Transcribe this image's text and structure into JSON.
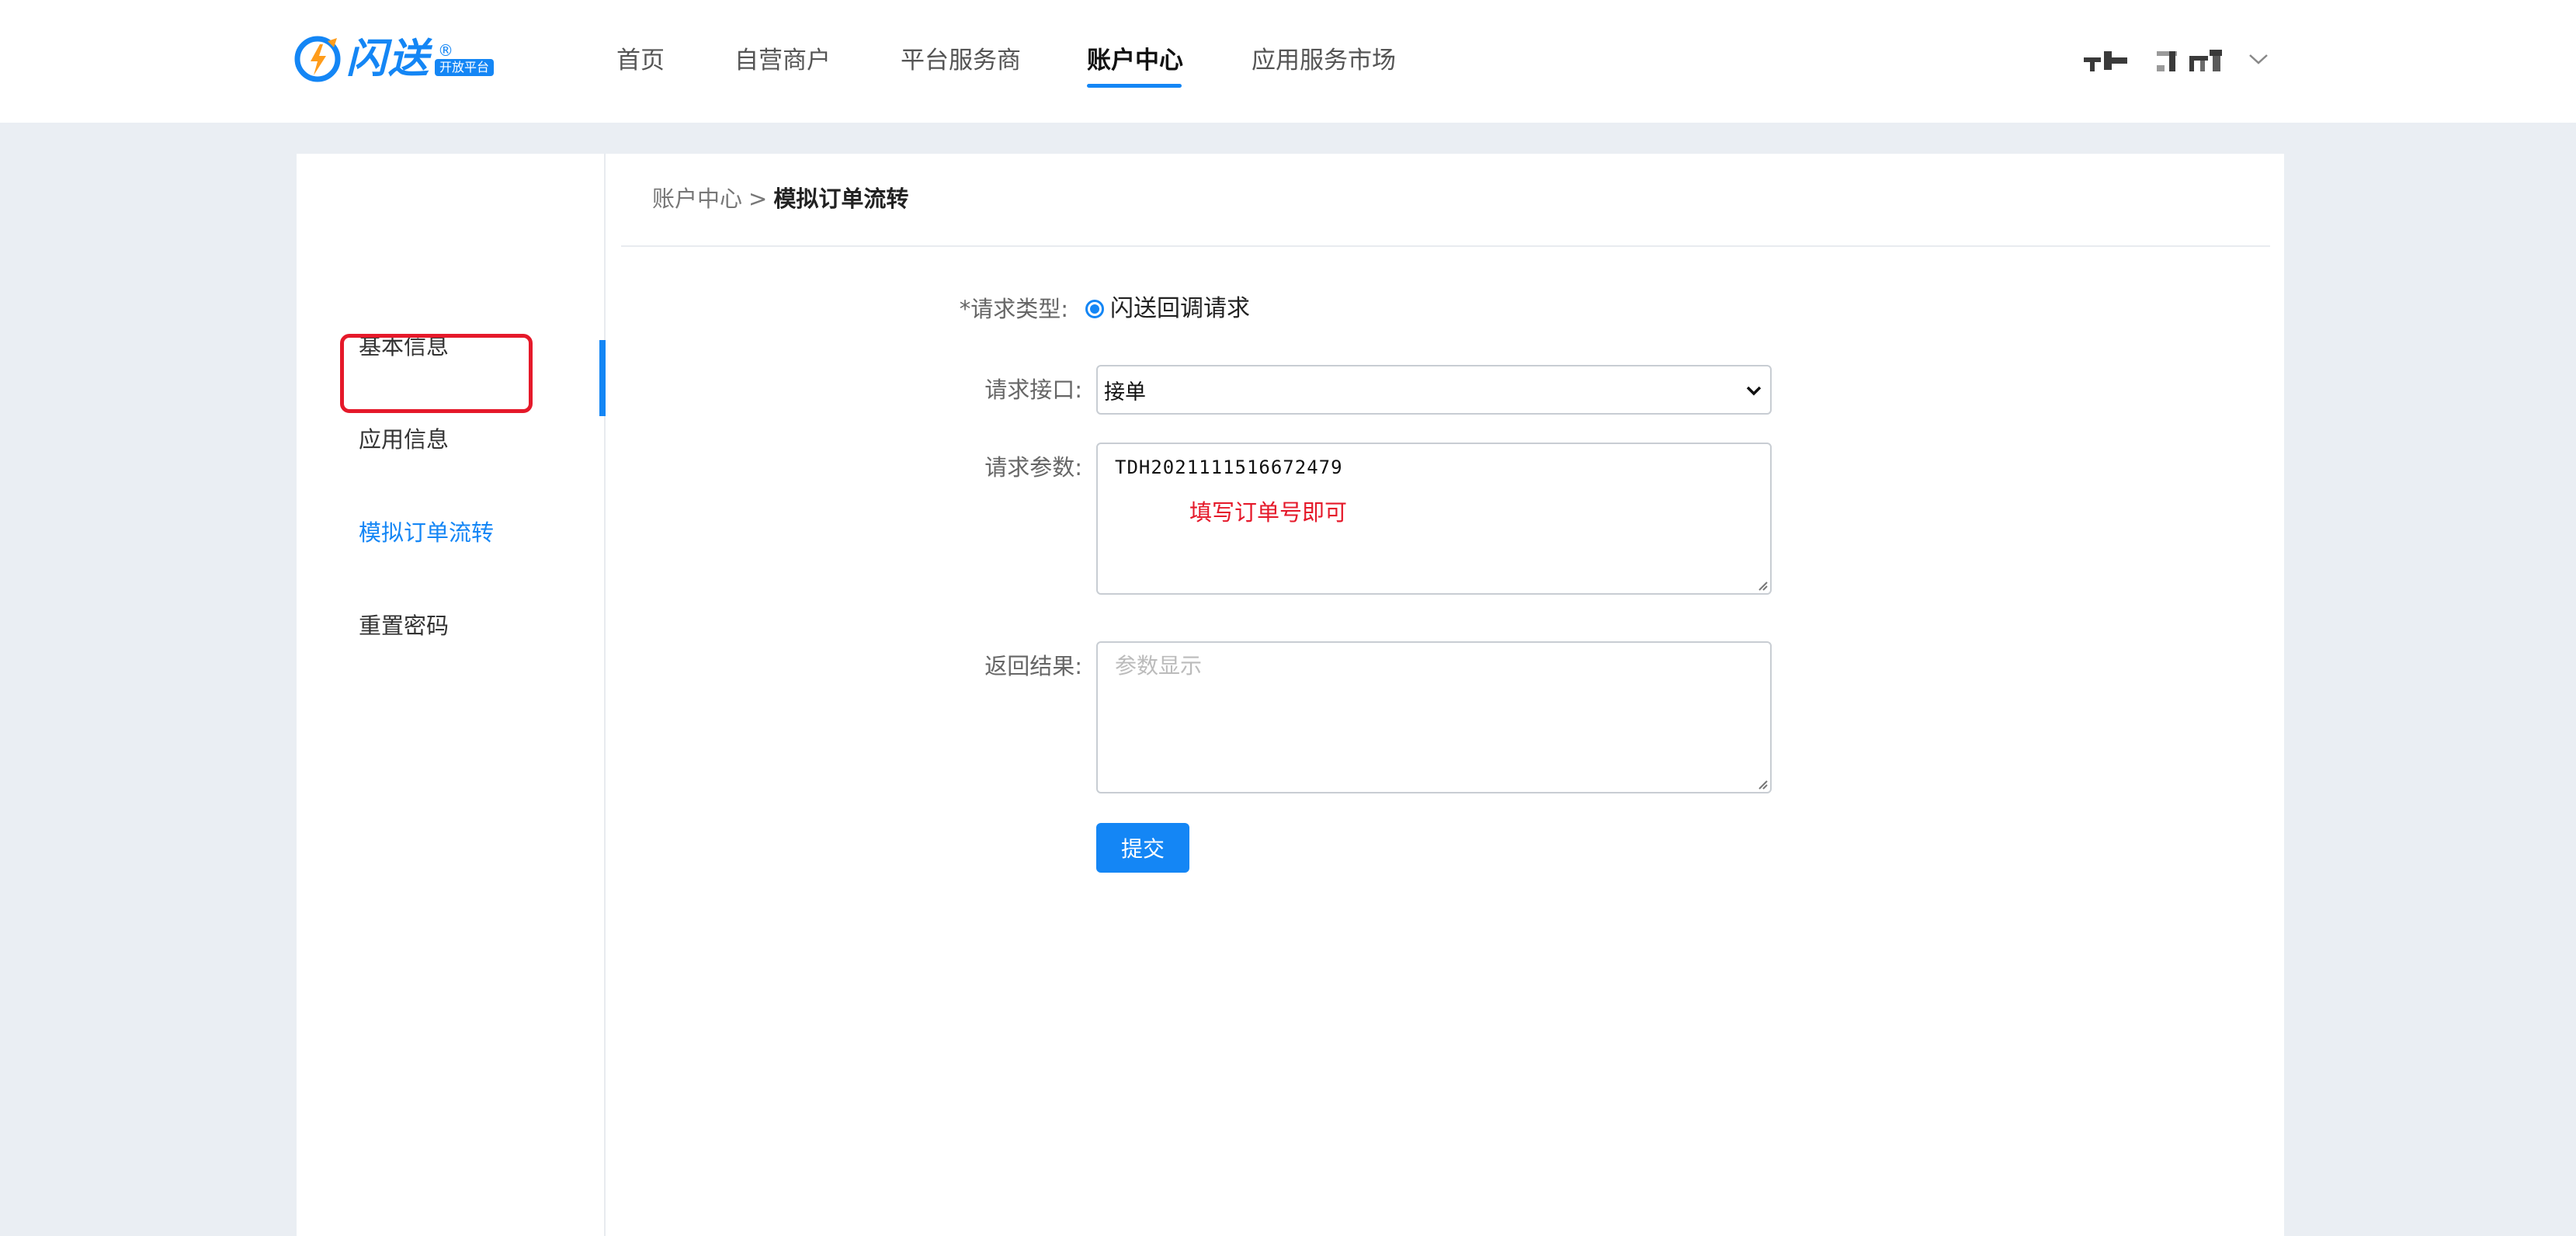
{
  "header": {
    "logo": {
      "brand": "闪送",
      "reg_mark": "®",
      "badge": "开放平台",
      "icon": "lightning-logo-icon"
    },
    "nav": [
      {
        "label": "首页"
      },
      {
        "label": "自营商户"
      },
      {
        "label": "平台服务商"
      },
      {
        "label": "账户中心",
        "active": true
      },
      {
        "label": "应用服务市场"
      }
    ],
    "user": {
      "chevron_icon": "chevron-down-icon"
    }
  },
  "sidebar": {
    "items": [
      {
        "label": "基本信息"
      },
      {
        "label": "应用信息"
      },
      {
        "label": "模拟订单流转",
        "active": true
      },
      {
        "label": "重置密码"
      }
    ]
  },
  "breadcrumb": {
    "parent": "账户中心",
    "separator": ">",
    "current": "模拟订单流转"
  },
  "form": {
    "request_type": {
      "label": "*请求类型:",
      "option": "闪送回调请求",
      "selected": true
    },
    "request_api": {
      "label": "请求接口:",
      "value": "接单"
    },
    "request_params": {
      "label": "请求参数:",
      "value": "TDH2021111516672479",
      "annotation": "填写订单号即可"
    },
    "result": {
      "label": "返回结果:",
      "placeholder": "参数显示"
    },
    "submit_label": "提交"
  },
  "colors": {
    "accent": "#1486f5",
    "highlight": "#e5192a",
    "background": "#eaeef3"
  }
}
